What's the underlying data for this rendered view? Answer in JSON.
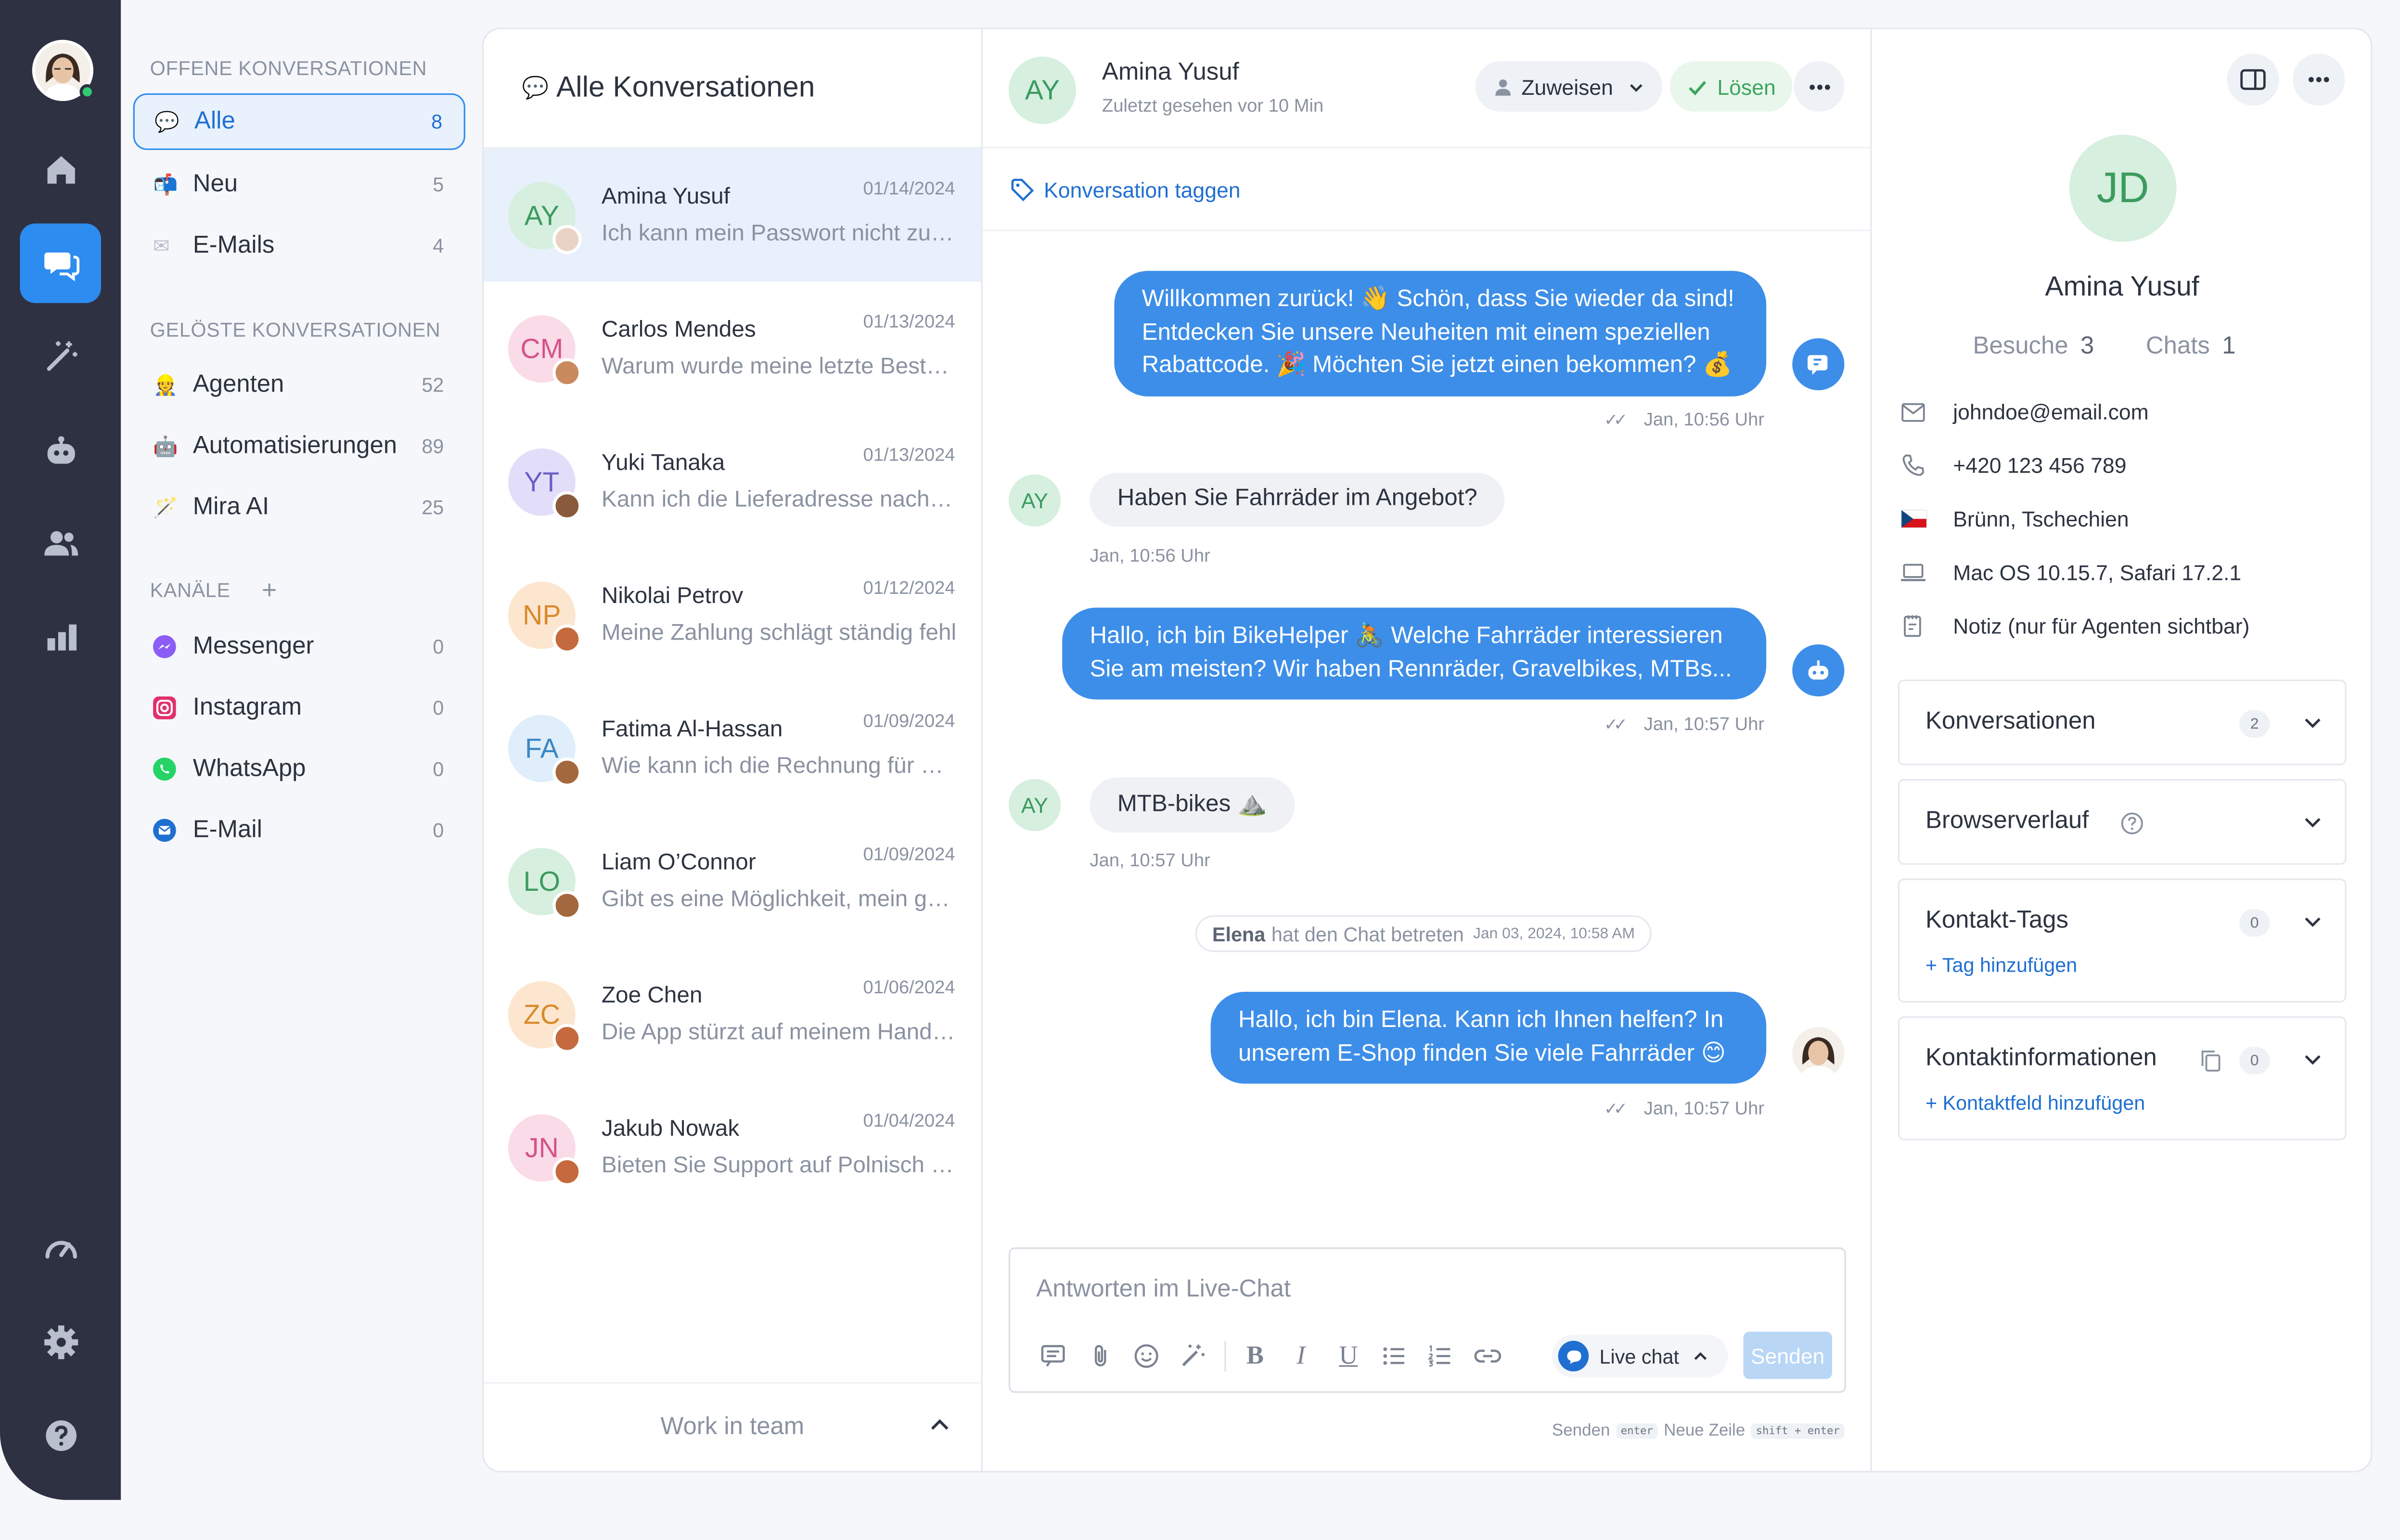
{
  "nav": {
    "items": [
      "home",
      "chats",
      "automation",
      "bot",
      "contacts",
      "reports",
      "speed",
      "settings",
      "help"
    ]
  },
  "folders": {
    "open_title": "OFFENE KONVERSATIONEN",
    "open": [
      {
        "label": "Alle",
        "count": "8",
        "icon": "speech-bubble-icon"
      },
      {
        "label": "Neu",
        "count": "5",
        "icon": "mailbox-icon"
      },
      {
        "label": "E-Mails",
        "count": "4",
        "icon": "envelope-icon"
      }
    ],
    "resolved_title": "GELÖSTE KONVERSATIONEN",
    "resolved": [
      {
        "label": "Agenten",
        "count": "52",
        "icon": "agent-icon"
      },
      {
        "label": "Automatisierungen",
        "count": "89",
        "icon": "robot-icon"
      },
      {
        "label": "Mira AI",
        "count": "25",
        "icon": "magic-wand-icon"
      }
    ],
    "channels_title": "KANÄLE",
    "channels": [
      {
        "label": "Messenger",
        "count": "0",
        "icon": "messenger-icon"
      },
      {
        "label": "Instagram",
        "count": "0",
        "icon": "instagram-icon"
      },
      {
        "label": "WhatsApp",
        "count": "0",
        "icon": "whatsapp-icon"
      },
      {
        "label": "E-Mail",
        "count": "0",
        "icon": "email-icon"
      }
    ]
  },
  "list": {
    "title": "Alle Konversationen",
    "conversations": [
      {
        "initials": "AY",
        "name": "Amina Yusuf",
        "date": "01/14/2024",
        "preview": "Ich kann mein Passwort nicht zurücksetzen",
        "bg": "#d6efdf",
        "fg": "#3b9b5e",
        "mini": "#e9d3c4"
      },
      {
        "initials": "CM",
        "name": "Carlos Mendes",
        "date": "01/13/2024",
        "preview": "Warum wurde meine letzte Bestellung storniert?",
        "bg": "#fadbe8",
        "fg": "#d4528a",
        "mini": "#c98a5e"
      },
      {
        "initials": "YT",
        "name": "Yuki Tanaka",
        "date": "01/13/2024",
        "preview": "Kann ich die Lieferadresse nachträglich ändern?",
        "bg": "#e2defa",
        "fg": "#6b5fc7",
        "mini": "#8a5a3c"
      },
      {
        "initials": "NP",
        "name": "Nikolai Petrov",
        "date": "01/12/2024",
        "preview": "Meine Zahlung schlägt ständig fehl",
        "bg": "#fde6cf",
        "fg": "#d98a2b",
        "mini": "#c46a3e"
      },
      {
        "initials": "FA",
        "name": "Fatima Al-Hassan",
        "date": "01/09/2024",
        "preview": "Wie kann ich die Rechnung für mein Konto finden?",
        "bg": "#dfeefa",
        "fg": "#3b87c4",
        "mini": "#a4683f"
      },
      {
        "initials": "LO",
        "name": "Liam O’Connor",
        "date": "01/09/2024",
        "preview": "Gibt es eine Möglichkeit, mein gelöschtes Konto wiederherzustellen?",
        "bg": "#d6efdf",
        "fg": "#3b9b5e",
        "mini": "#a4683f"
      },
      {
        "initials": "ZC",
        "name": "Zoe Chen",
        "date": "01/06/2024",
        "preview": "Die App stürzt auf meinem Handy ständig ab",
        "bg": "#fde6cf",
        "fg": "#d98a2b",
        "mini": "#c46a3e"
      },
      {
        "initials": "JN",
        "name": "Jakub Nowak",
        "date": "01/04/2024",
        "preview": "Bieten Sie Support auf Polnisch oder Tschechisch an?",
        "bg": "#fadbe8",
        "fg": "#d4528a",
        "mini": "#c46a3e"
      }
    ],
    "footer": "Work in team"
  },
  "chat": {
    "contact_initials": "AY",
    "contact_name": "Amina Yusuf",
    "last_seen": "Zuletzt gesehen vor 10 Min",
    "assign_label": "Zuweisen",
    "resolve_label": "Lösen",
    "tag_label": "Konversation taggen",
    "messages": [
      {
        "dir": "out",
        "text": "Willkommen zurück! 👋 Schön, dass Sie wieder da sind! Entdecken Sie unsere Neuheiten mit einem speziellen Rabattcode. 🎉 Möchten Sie jetzt einen bekommen? 💰",
        "time": "Jan, 10:56 Uhr"
      },
      {
        "dir": "in",
        "text": "Haben Sie Fahrräder im Angebot?",
        "time": "Jan, 10:56 Uhr"
      },
      {
        "dir": "out",
        "text": "Hallo, ich bin BikeHelper 🚴 Welche Fahrräder interessieren Sie am meisten? Wir haben Rennräder, Gravelbikes, MTBs...",
        "time": "Jan, 10:57 Uhr"
      },
      {
        "dir": "in",
        "text": "MTB-bikes ⛰️",
        "time": "Jan, 10:57 Uhr"
      },
      {
        "dir": "out",
        "text": "Hallo, ich bin Elena. Kann ich Ihnen helfen? In unserem E-Shop finden Sie viele Fahrräder 😊",
        "time": "Jan, 10:57 Uhr"
      }
    ],
    "system_name": "Elena",
    "system_text": "hat den Chat betreten",
    "system_time": "Jan 03, 2024, 10:58 AM",
    "composer_placeholder": "Antworten im Live-Chat",
    "channel_label": "Live chat",
    "send_label": "Senden",
    "hint_send": "Senden",
    "hint_send_key": "enter",
    "hint_newline": "Neue Zeile",
    "hint_newline_key": "shift + enter"
  },
  "profile": {
    "initials": "JD",
    "name": "Amina Yusuf",
    "visits_label": "Besuche",
    "visits": "3",
    "chats_label": "Chats",
    "chats": "1",
    "email": "johndoe@email.com",
    "phone": "+420 123 456 789",
    "location": "Brünn, Tschechien",
    "device": "Mac OS 10.15.7, Safari 17.2.1",
    "note": "Notiz (nur für Agenten sichtbar)",
    "cards": {
      "conversations": {
        "title": "Konversationen",
        "count": "2"
      },
      "history": {
        "title": "Browserverlauf"
      },
      "tags": {
        "title": "Kontakt-Tags",
        "count": "0",
        "link": "+ Tag hinzufügen"
      },
      "contactinfo": {
        "title": "Kontaktinformationen",
        "count": "0",
        "link": "+ Kontaktfeld hinzufügen"
      }
    }
  },
  "colors": {
    "accent": "#2d8cf0",
    "rail": "#2e3142",
    "bubble_out": "#3d8ee8"
  }
}
